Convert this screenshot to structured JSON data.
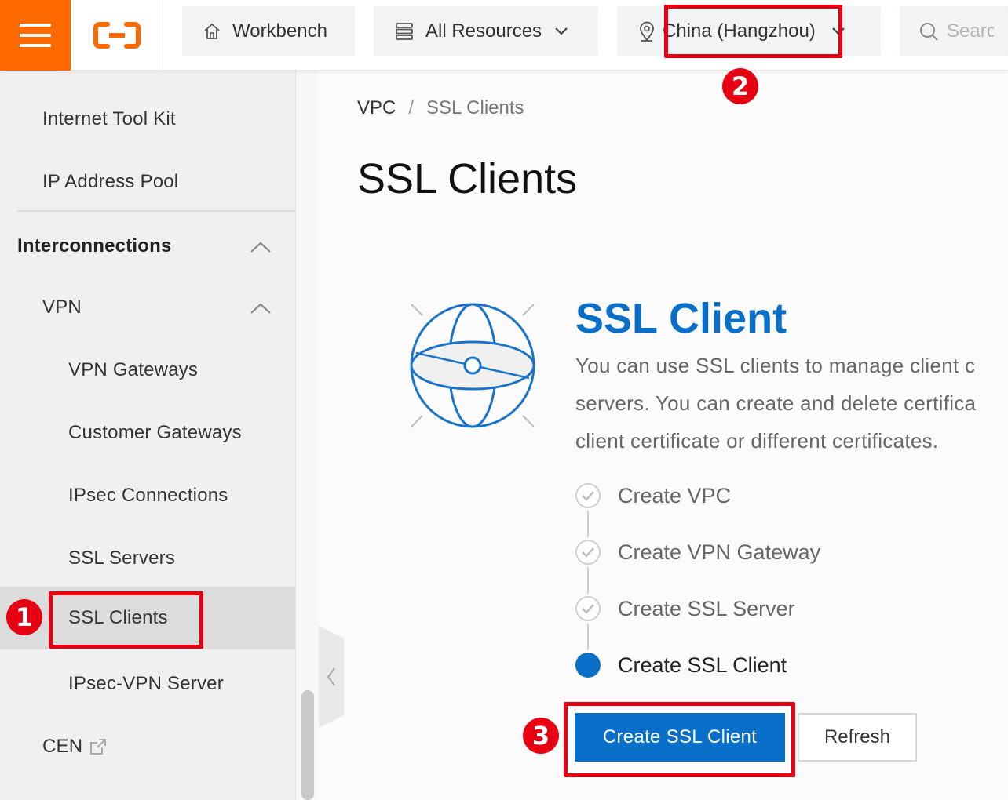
{
  "topbar": {
    "workbench_label": "Workbench",
    "resources_label": "All Resources",
    "region_label": "China (Hangzhou)",
    "search_placeholder": "Search"
  },
  "sidebar": {
    "items": [
      {
        "label": "Internet Tool Kit"
      },
      {
        "label": "IP Address Pool"
      },
      {
        "label": "Interconnections"
      },
      {
        "label": "VPN"
      },
      {
        "label": "VPN Gateways"
      },
      {
        "label": "Customer Gateways"
      },
      {
        "label": "IPsec Connections"
      },
      {
        "label": "SSL Servers"
      },
      {
        "label": "SSL Clients"
      },
      {
        "label": "IPsec-VPN Server"
      },
      {
        "label": "CEN"
      }
    ]
  },
  "breadcrumb": {
    "root": "VPC",
    "separator": "/",
    "current": "SSL Clients"
  },
  "page_title": "SSL Clients",
  "card": {
    "title": "SSL Client",
    "desc_lines": [
      "You can use SSL clients to manage client c",
      "servers. You can create and delete certifica",
      "client certificate or different certificates."
    ],
    "steps": [
      {
        "label": "Create VPC",
        "status": "done"
      },
      {
        "label": "Create VPN Gateway",
        "status": "done"
      },
      {
        "label": "Create SSL Server",
        "status": "done"
      },
      {
        "label": "Create SSL Client",
        "status": "current"
      }
    ]
  },
  "actions": {
    "create_label": "Create SSL Client",
    "refresh_label": "Refresh"
  },
  "annotations": {
    "badge_1": "1",
    "badge_2": "2",
    "badge_3": "3"
  },
  "colors": {
    "brand_orange": "#ff6a00",
    "primary_blue": "#0a6fc8",
    "highlight_red": "#e60012"
  }
}
